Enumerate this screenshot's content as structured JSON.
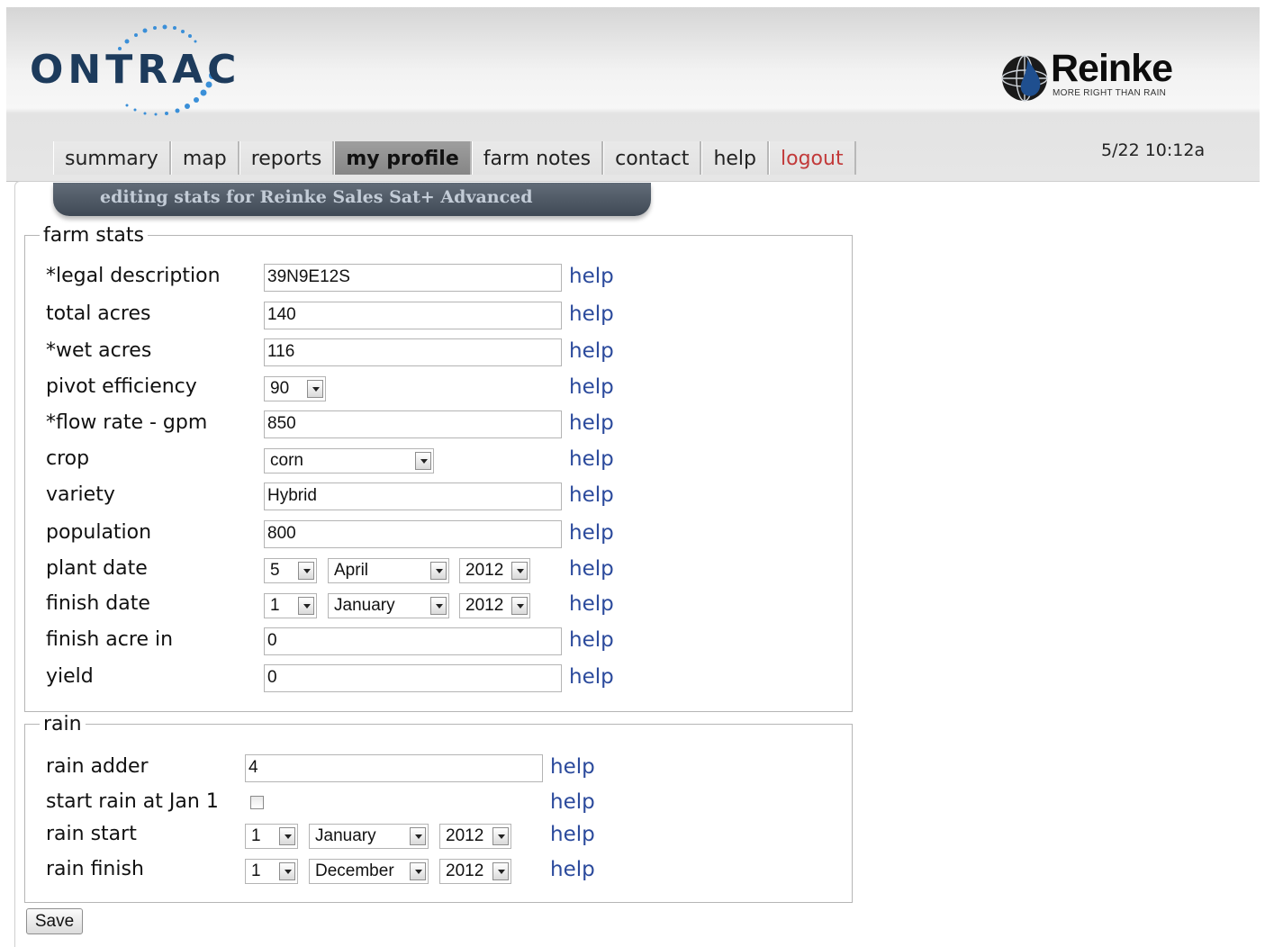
{
  "header": {
    "logo_text": "ONTRAC",
    "brand_name": "Reinke",
    "brand_tagline": "MORE RIGHT THAN RAIN",
    "datetime": "5/22 10:12a",
    "colors": {
      "ontrac_navy": "#1d3b5c",
      "ontrac_dots": "#3a8fd8",
      "reinke_blue": "#1f4f8f"
    }
  },
  "nav": {
    "tabs": [
      {
        "label": "summary"
      },
      {
        "label": "map"
      },
      {
        "label": "reports"
      },
      {
        "label": "my profile",
        "active": true
      },
      {
        "label": "farm notes"
      },
      {
        "label": "contact"
      },
      {
        "label": "help"
      },
      {
        "label": "logout"
      }
    ]
  },
  "banner": {
    "text": "editing stats for Reinke Sales Sat+ Advanced"
  },
  "farm_stats": {
    "legend": "farm stats",
    "help_label": "help",
    "legal_description": {
      "label": "*legal description",
      "value": "39N9E12S"
    },
    "total_acres": {
      "label": "total acres",
      "value": "140"
    },
    "wet_acres": {
      "label": "*wet acres",
      "value": "116"
    },
    "pivot_efficiency": {
      "label": "pivot efficiency",
      "value": "90"
    },
    "flow_rate": {
      "label": "*flow rate - gpm",
      "value": "850"
    },
    "crop": {
      "label": "crop",
      "value": "corn"
    },
    "variety": {
      "label": "variety",
      "value": "Hybrid"
    },
    "population": {
      "label": "population",
      "value": "800"
    },
    "plant_date": {
      "label": "plant date",
      "day": "5",
      "month": "April",
      "year": "2012"
    },
    "finish_date": {
      "label": "finish date",
      "day": "1",
      "month": "January",
      "year": "2012"
    },
    "finish_acre_in": {
      "label": "finish acre in",
      "value": "0"
    },
    "yield": {
      "label": "yield",
      "value": "0"
    }
  },
  "rain": {
    "legend": "rain",
    "help_label": "help",
    "rain_adder": {
      "label": "rain adder",
      "value": "4"
    },
    "start_rain_jan1": {
      "label": "start rain at Jan 1",
      "checked": false
    },
    "rain_start": {
      "label": "rain start",
      "day": "1",
      "month": "January",
      "year": "2012"
    },
    "rain_finish": {
      "label": "rain finish",
      "day": "1",
      "month": "December",
      "year": "2012"
    }
  },
  "save_label": "Save"
}
